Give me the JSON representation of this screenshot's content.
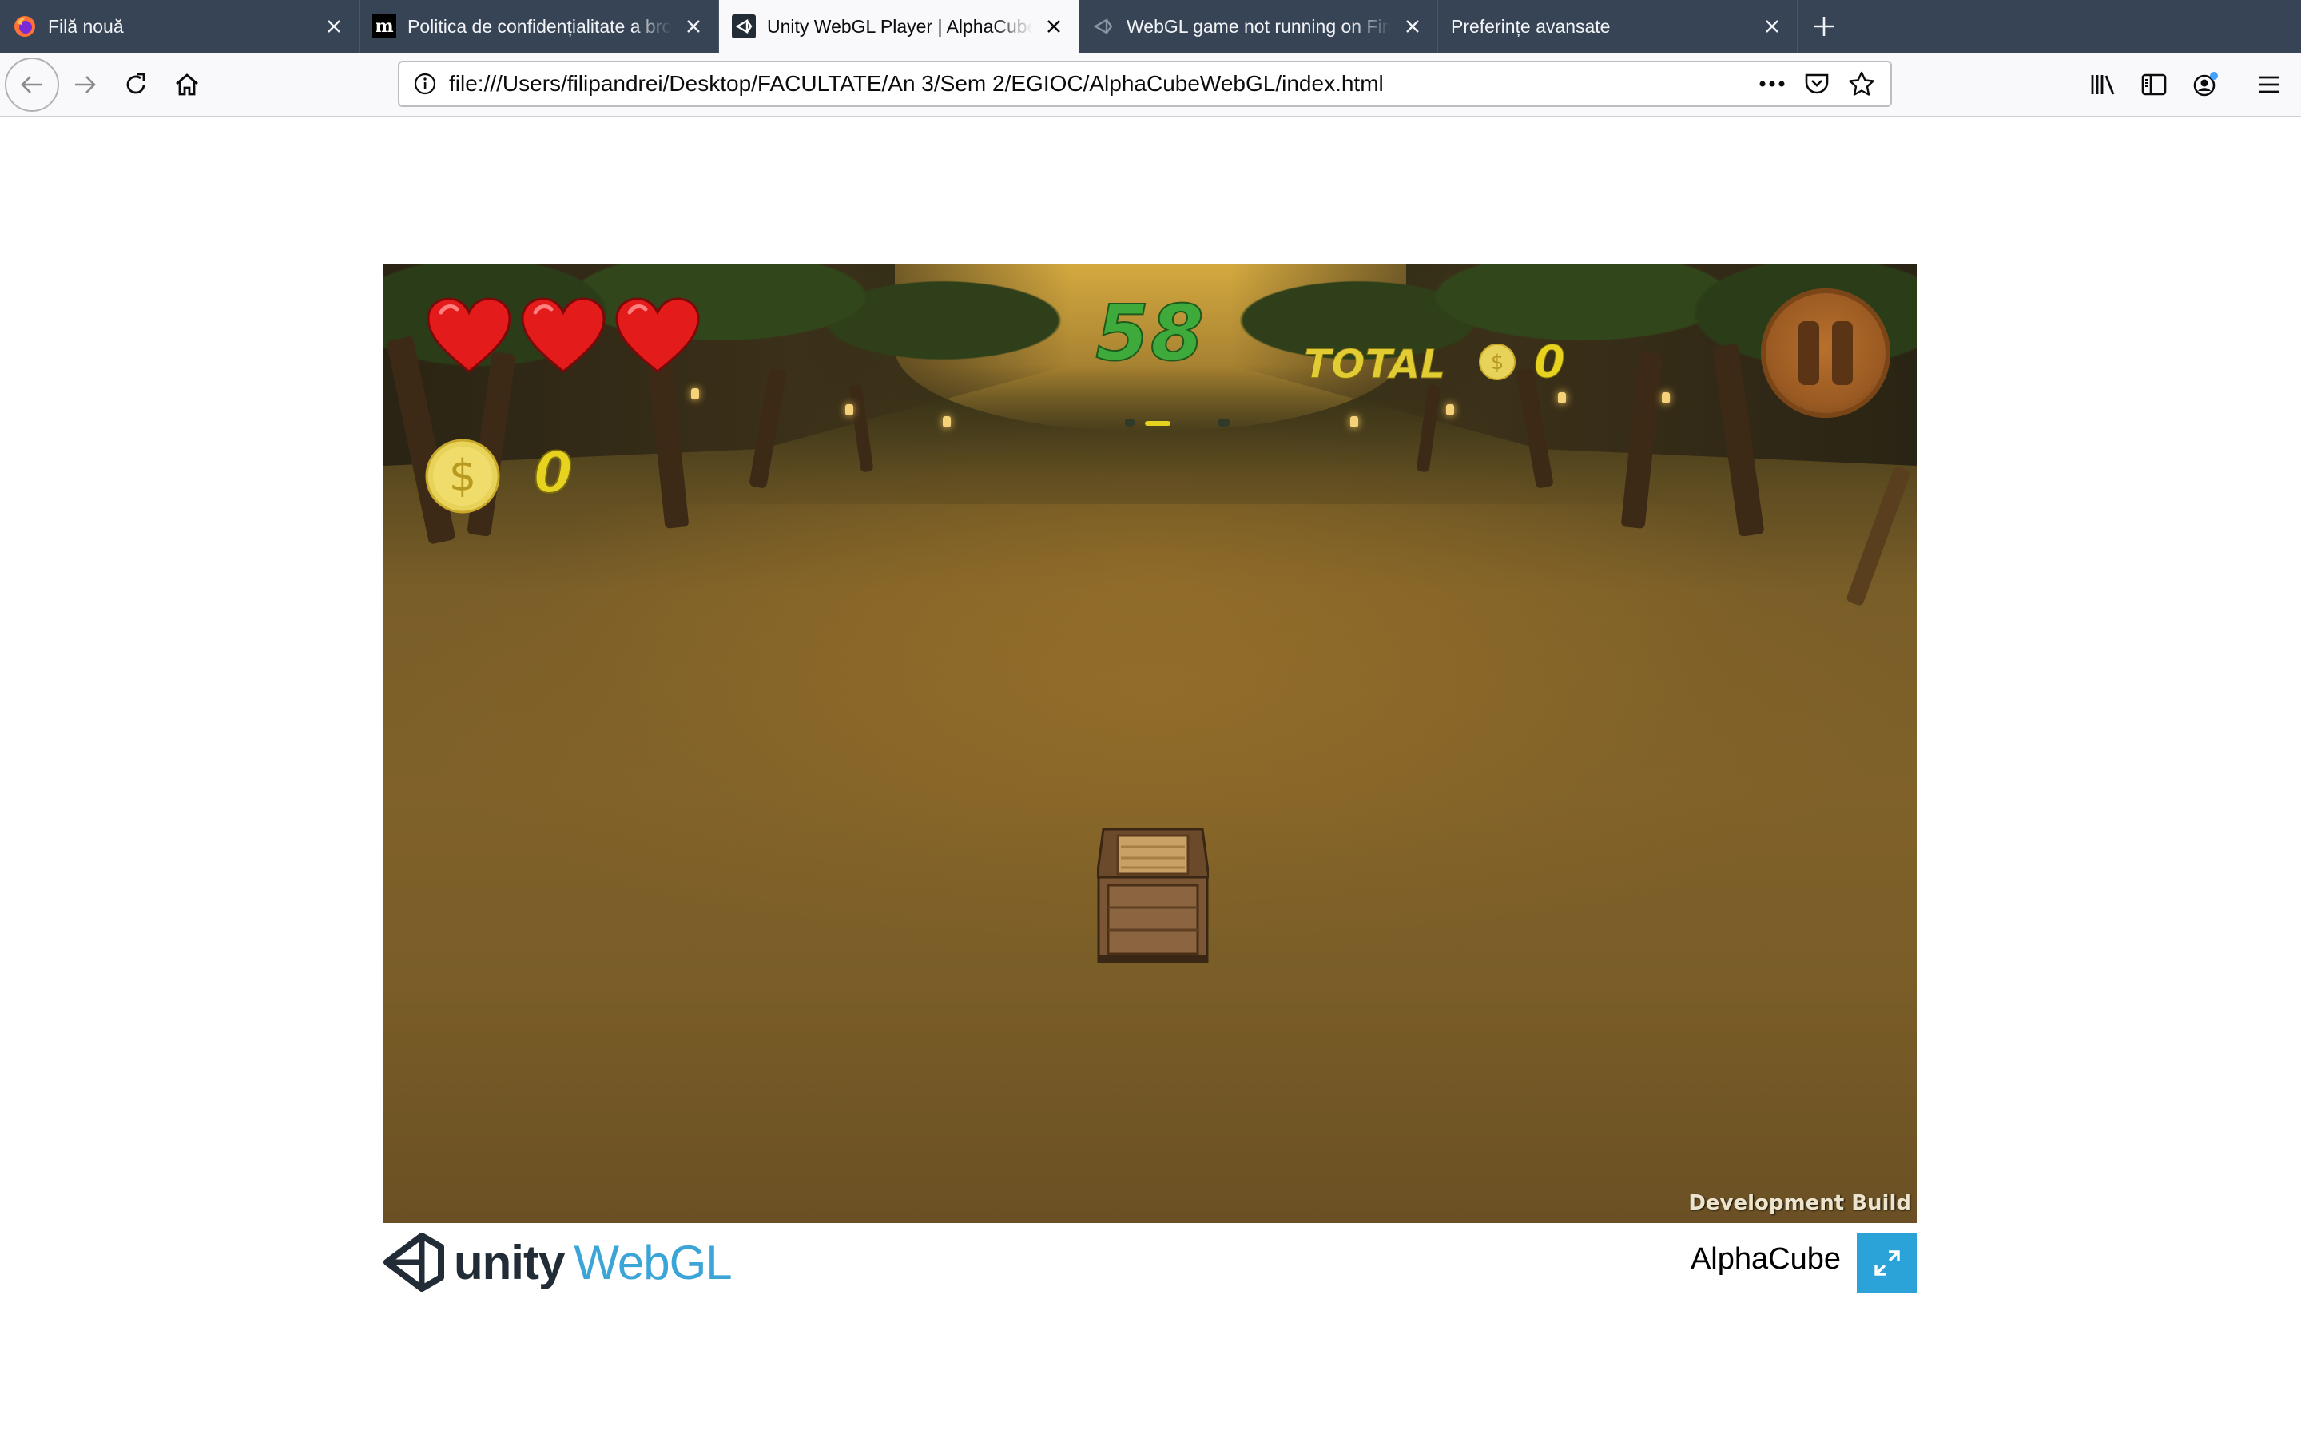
{
  "browser": {
    "tabs": [
      {
        "title": "Filă nouă",
        "icon": "firefox-icon",
        "active": false
      },
      {
        "title": "Politica de confidențialitate a browserului",
        "icon": "m-logo-icon",
        "active": false
      },
      {
        "title": "Unity WebGL Player | AlphaCube",
        "icon": "unity-icon",
        "active": true
      },
      {
        "title": "WebGL game not running on Firefox",
        "icon": "unity-icon",
        "active": false
      },
      {
        "title": "Preferințe avansate",
        "icon": "",
        "active": false
      }
    ],
    "url": "file:///Users/filipandrei/Desktop/FACULTATE/An 3/Sem 2/EGIOC/AlphaCubeWebGL/index.html",
    "colors": {
      "tabstrip": "#374455",
      "navbar": "#f9f9fb",
      "notification_dot": "#45a1ff"
    }
  },
  "game": {
    "hud": {
      "lives": 3,
      "coins": "0",
      "score": "58",
      "total_label": "TOTAL",
      "total_value": "0",
      "coin_symbol": "$"
    },
    "dev_build_label": "Development Build",
    "colors": {
      "heart": "#e31b1b",
      "score": "#3eaa3b",
      "coin": "#e6d21f",
      "pause": "#9a5a22"
    }
  },
  "footer": {
    "logo_unity": "unity",
    "logo_webgl": "WebGL",
    "game_title": "AlphaCube",
    "colors": {
      "fullscreen": "#2ba3d8",
      "webgl": "#3aa5d6",
      "unity": "#222c37"
    }
  }
}
